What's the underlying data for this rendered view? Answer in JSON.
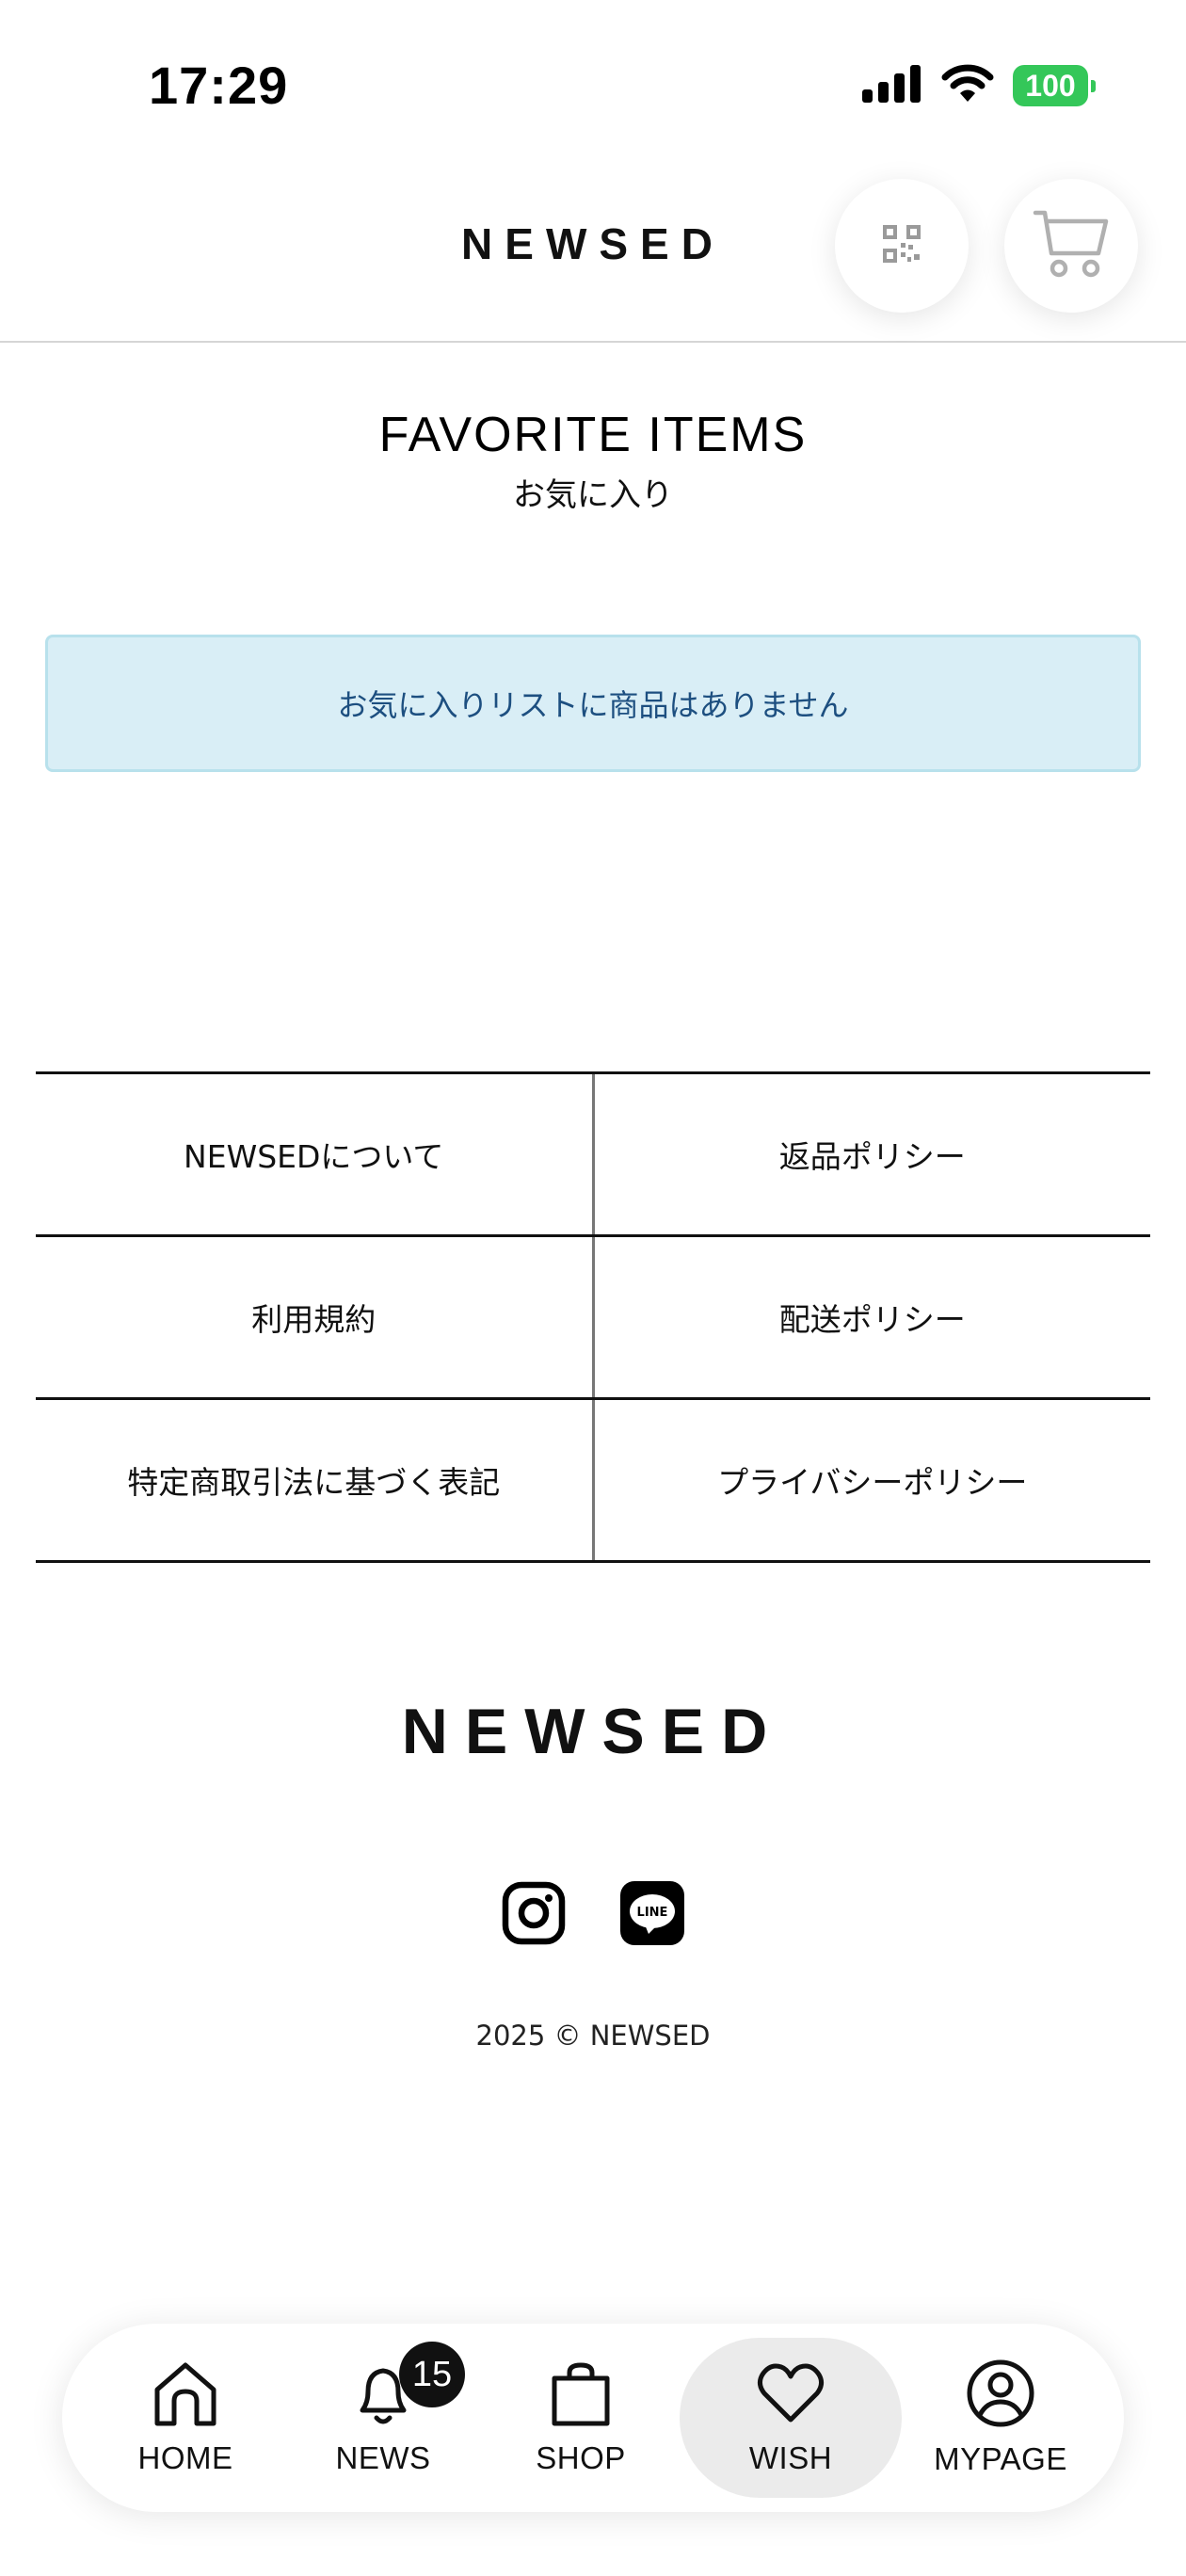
{
  "status_bar": {
    "time": "17:29",
    "battery": "100"
  },
  "header": {
    "brand": "NEWSED"
  },
  "page": {
    "title_en": "FAVORITE ITEMS",
    "title_jp": "お気に入り"
  },
  "notice": {
    "empty_message": "お気に入りリストに商品はありません"
  },
  "footer_links": [
    {
      "label": "NEWSEDについて"
    },
    {
      "label": "返品ポリシー"
    },
    {
      "label": "利用規約"
    },
    {
      "label": "配送ポリシー"
    },
    {
      "label": "特定商取引法に基づく表記"
    },
    {
      "label": "プライバシーポリシー"
    }
  ],
  "footer": {
    "brand": "NEWSED",
    "social": [
      {
        "icon": "instagram-icon"
      },
      {
        "icon": "line-icon",
        "text": "LINE"
      }
    ],
    "copyright": "2025 © NEWSED"
  },
  "tabbar": {
    "active": "wish",
    "tabs": [
      {
        "id": "home",
        "label": "HOME",
        "icon": "home-icon"
      },
      {
        "id": "news",
        "label": "NEWS",
        "icon": "bell-icon",
        "badge": "15"
      },
      {
        "id": "shop",
        "label": "SHOP",
        "icon": "shopping-bag-icon"
      },
      {
        "id": "wish",
        "label": "WISH",
        "icon": "heart-icon"
      },
      {
        "id": "mypage",
        "label": "MYPAGE",
        "icon": "user-icon"
      }
    ]
  },
  "colors": {
    "notice_bg": "#d9eef6",
    "notice_text": "#1d4f80",
    "battery": "#34c759",
    "active_tab_bg": "#ebebeb"
  }
}
